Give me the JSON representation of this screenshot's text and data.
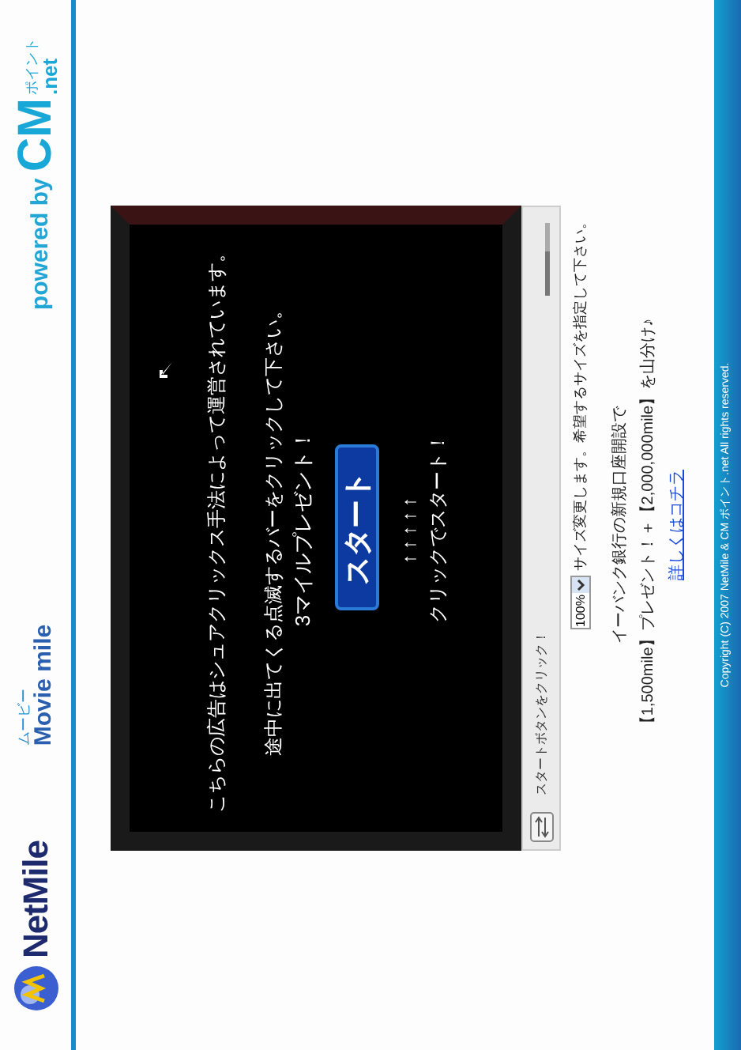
{
  "header": {
    "brand": "NetMile",
    "sub_brand_kana": "ムービー",
    "sub_brand": "Movie mile",
    "powered_by": "powered by",
    "partner": "CM",
    "partner_kana": "ポイント",
    "partner_suffix": ".net"
  },
  "player": {
    "lines": [
      "こちらの広告はシュアクリックス手法によって運営されています。",
      "途中に出てくる点滅するバーをクリックして下さい。",
      "3マイルプレゼント！"
    ],
    "start_button": "スタート",
    "arrows": "↑↑↑↑↑",
    "click_hint": "クリックでスタート！",
    "status": "スタートボタンをクリック！",
    "volume": {
      "level": 0.6
    }
  },
  "size": {
    "value": "100%",
    "note": "サイズ変更します。希望するサイズを指定して下さい。"
  },
  "promo": {
    "lines": [
      "イーバンク銀行の新規口座開設で",
      "【1,500mile】プレゼント！＋【2,000,000mile】を山分け♪"
    ],
    "link": "詳しくはコチラ"
  },
  "footer": {
    "copyright": "Copyright (C) 2007 NetMile & CM ポイント.net All rights reserved."
  }
}
